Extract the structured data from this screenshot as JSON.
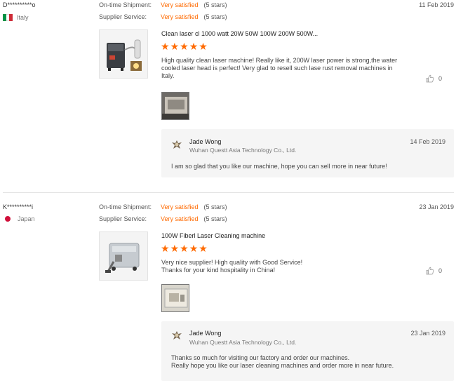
{
  "reviews": [
    {
      "buyer": "D**********o",
      "country": "Italy",
      "date": "11 Feb 2019",
      "shipment_label": "On-time Shipment:",
      "shipment_value": "Very satisfied",
      "shipment_stars": "(5 stars)",
      "service_label": "Supplier Service:",
      "service_value": "Very satisfied",
      "service_stars": "(5 stars)",
      "product_title": "Clean laser cl 1000 watt 20W 50W 100W 200W 500W...",
      "rating": 5,
      "comment": "High quality clean laser machine! Really like it, 200W laser power is strong,the water cooled laser head is perfect! Very glad to resell such lase rust removal machines in Italy.",
      "likes": "0",
      "reply": {
        "name": "Jade Wong",
        "company": "Wuhan Questt Asia Technology Co., Ltd.",
        "date": "14 Feb 2019",
        "text": "I am so glad that you like our machine, hope you can sell more in near future!"
      }
    },
    {
      "buyer": "K**********i",
      "country": "Japan",
      "date": "23 Jan 2019",
      "shipment_label": "On-time Shipment:",
      "shipment_value": "Very satisfied",
      "shipment_stars": "(5 stars)",
      "service_label": "Supplier Service:",
      "service_value": "Very satisfied",
      "service_stars": "(5 stars)",
      "product_title": "100W Fiberl Laser Cleaning machine",
      "rating": 5,
      "comment_line1": "Very nice supplier! High quality with Good Service!",
      "comment_line2": "Thanks for your kind hospitality in China!",
      "likes": "0",
      "reply": {
        "name": "Jade Wong",
        "company": "Wuhan Questt Asia Technology Co., Ltd.",
        "date": "23 Jan 2019",
        "text_line1": "Thanks so much for visiting our factory and order our machines.",
        "text_line2": "Really hope you like our laser cleaning machines and order more in near future."
      }
    }
  ],
  "colors": {
    "accent": "#ff6a00",
    "reply_bg": "#f5f5f5",
    "divider": "#e5e5e5"
  },
  "icons": {
    "star": "star-icon",
    "like": "thumbs-up-icon",
    "avatar": "company-logo-icon"
  }
}
